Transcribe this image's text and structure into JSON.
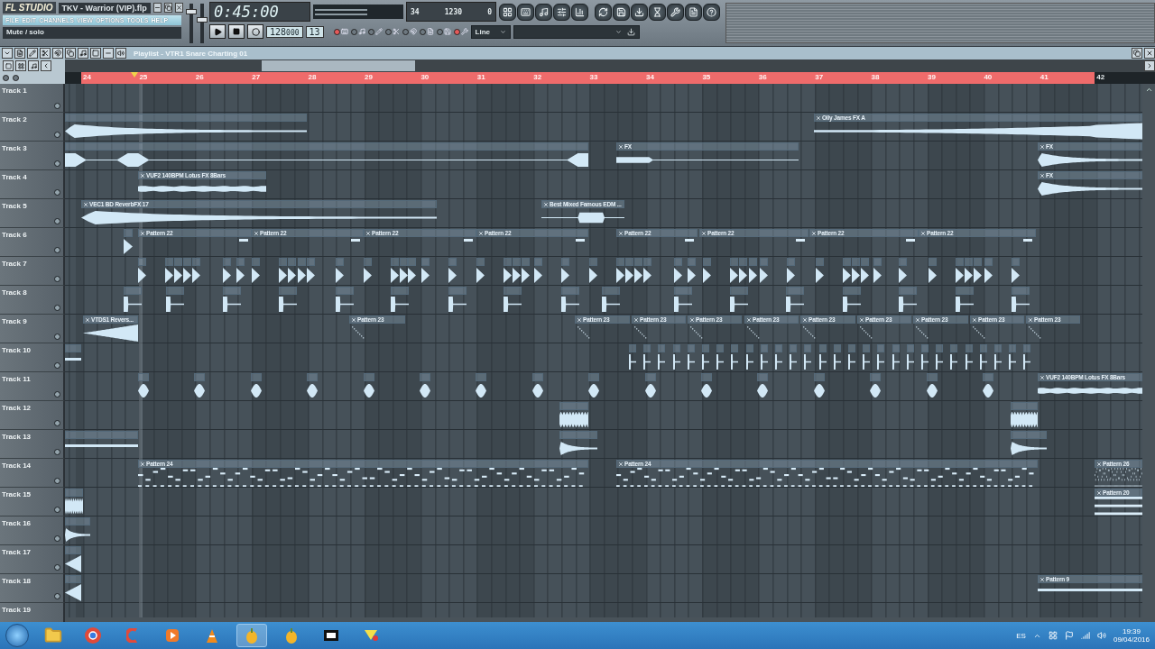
{
  "app": {
    "logo": "FL STUDIO",
    "project": "TKV - Warrior (VIP).flp",
    "menu": [
      "FILE",
      "EDIT",
      "CHANNELS",
      "VIEW",
      "OPTIONS",
      "TOOLS",
      "HELP"
    ],
    "hint": "Mute / solo"
  },
  "sliders": [
    {
      "level": 0.85
    },
    {
      "level": 0.6
    }
  ],
  "transport": {
    "time": "0:45:00",
    "tempo": "128",
    "tempo_fraction": "000",
    "pattern": "13",
    "cpu": "34",
    "memory": "1230",
    "polyphony": "0",
    "snap": "Line"
  },
  "playlist": {
    "title": "Playlist - VTR1 Snare Charting 01",
    "ruler": [
      "24",
      "25",
      "26",
      "27",
      "28",
      "29",
      "30",
      "31",
      "32",
      "33",
      "34",
      "35",
      "36",
      "37",
      "38",
      "39",
      "40",
      "41",
      "42"
    ],
    "tracks": [
      {
        "name": "Track 1"
      },
      {
        "name": "Track 2",
        "clips": [
          {
            "label": "Olly James FX A"
          }
        ]
      },
      {
        "name": "Track 3",
        "clips": [
          {
            "label": "FX"
          },
          {
            "label": "FX"
          }
        ]
      },
      {
        "name": "Track 4",
        "clips": [
          {
            "label": "VUF2 140BPM Lotus FX 8Bars"
          },
          {
            "label": "FX"
          }
        ]
      },
      {
        "name": "Track 5",
        "clips": [
          {
            "label": "VEC1 BD ReverbFX 17"
          },
          {
            "label": "Best Mixed Famous EDM ..."
          }
        ]
      },
      {
        "name": "Track 6",
        "clips": [
          {
            "label": "Pattern 22"
          },
          {
            "label": "Pattern 22"
          },
          {
            "label": "Pattern 22"
          },
          {
            "label": "Pattern 22"
          },
          {
            "label": "Pattern 22"
          },
          {
            "label": "Pattern 22"
          },
          {
            "label": "Pattern 22"
          },
          {
            "label": "Pattern 22"
          }
        ]
      },
      {
        "name": "Track 7"
      },
      {
        "name": "Track 8"
      },
      {
        "name": "Track 9",
        "clips": [
          {
            "label": "VTDS1 Revers..."
          },
          {
            "label": "Pattern 23"
          },
          {
            "label": "Pattern 23"
          },
          {
            "label": "Pattern 23"
          },
          {
            "label": "Pattern 23"
          },
          {
            "label": "Pattern 23"
          },
          {
            "label": "Pattern 23"
          },
          {
            "label": "Pattern 23"
          },
          {
            "label": "Pattern 23"
          },
          {
            "label": "Pattern 23"
          },
          {
            "label": "Pattern 23"
          }
        ]
      },
      {
        "name": "Track 10"
      },
      {
        "name": "Track 11",
        "clips": [
          {
            "label": "VUF2 140BPM Lotus FX 8Bars"
          }
        ]
      },
      {
        "name": "Track 12"
      },
      {
        "name": "Track 13"
      },
      {
        "name": "Track 14",
        "clips": [
          {
            "label": "Pattern 24"
          },
          {
            "label": "Pattern 24"
          },
          {
            "label": "Pattern 26"
          }
        ]
      },
      {
        "name": "Track 15",
        "clips": [
          {
            "label": "Pattern 20"
          }
        ]
      },
      {
        "name": "Track 16"
      },
      {
        "name": "Track 17"
      },
      {
        "name": "Track 18",
        "clips": [
          {
            "label": "Pattern 9"
          }
        ]
      },
      {
        "name": "Track 19"
      }
    ]
  },
  "taskbar": {
    "language": "ES",
    "time": "19:39",
    "date": "09/04/2016"
  }
}
